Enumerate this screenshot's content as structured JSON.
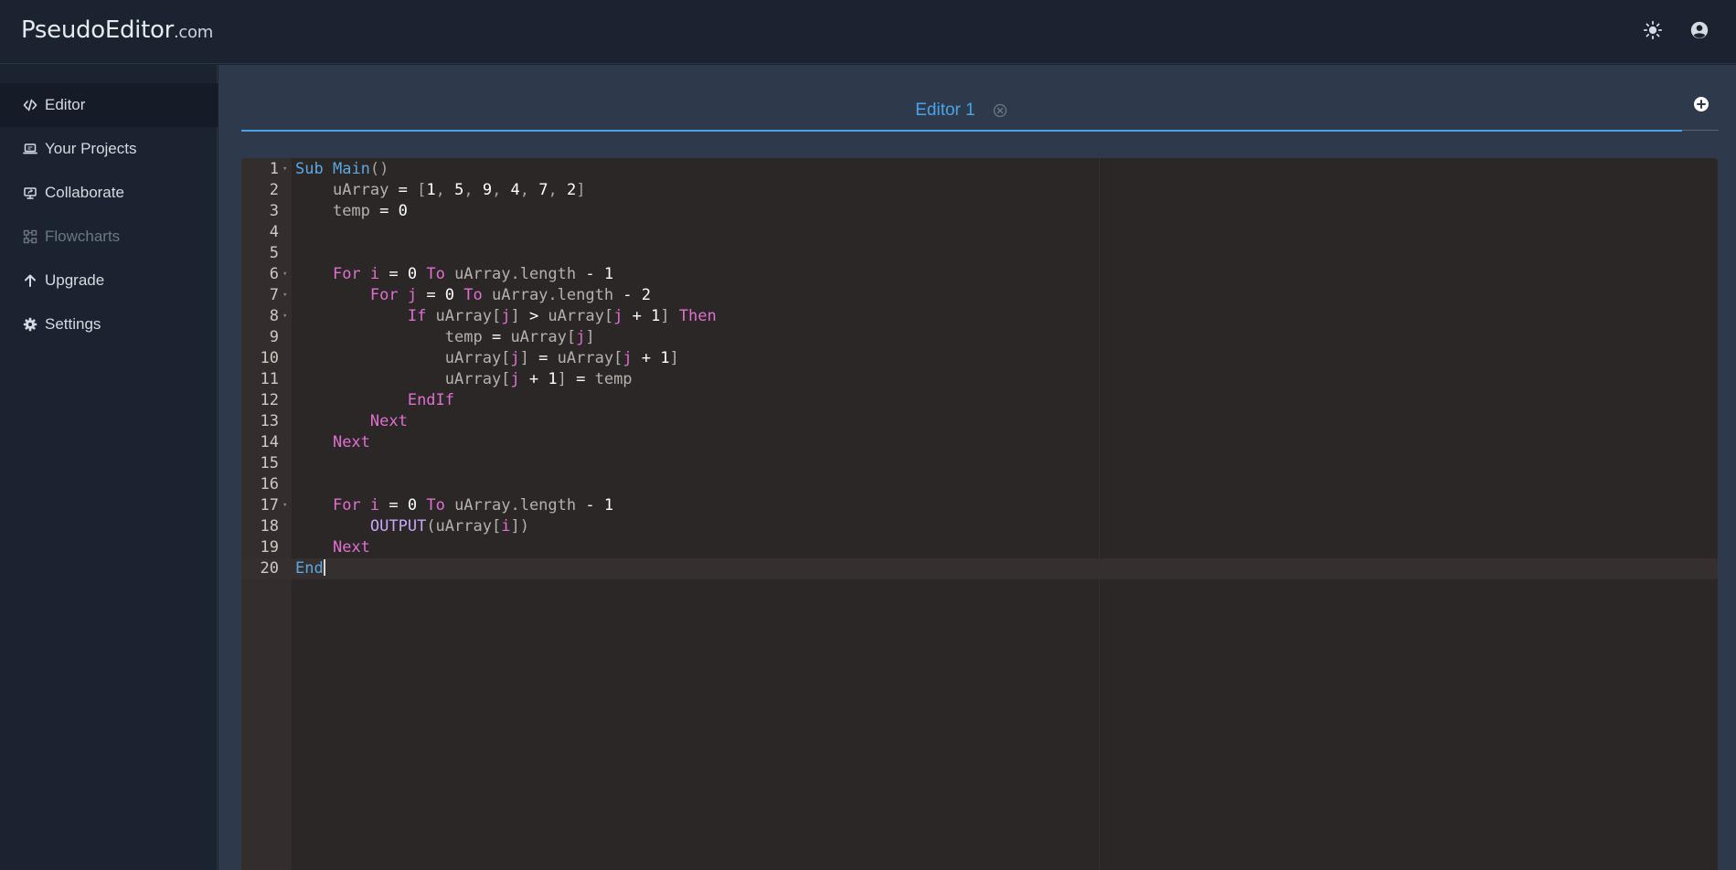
{
  "app": {
    "logo_main": "PseudoEditor",
    "logo_tld": ".com",
    "theme_icon": "sun-icon",
    "account_icon": "user-circle-icon"
  },
  "sidebar": {
    "items": [
      {
        "label": "Editor",
        "icon": "code-icon",
        "state": "active"
      },
      {
        "label": "Your Projects",
        "icon": "laptop-icon",
        "state": "normal"
      },
      {
        "label": "Collaborate",
        "icon": "share-screen-icon",
        "state": "normal"
      },
      {
        "label": "Flowcharts",
        "icon": "flowchart-icon",
        "state": "disabled"
      },
      {
        "label": "Upgrade",
        "icon": "arrow-up-icon",
        "state": "normal"
      },
      {
        "label": "Settings",
        "icon": "gear-icon",
        "state": "normal"
      }
    ]
  },
  "tabs": [
    {
      "label": "Editor 1",
      "active": true
    }
  ],
  "editor": {
    "current_line": 20,
    "lines": [
      [
        [
          "kw-blue",
          "Sub"
        ],
        [
          "",
          "' '"
        ],
        [
          "kw-blue",
          "Main"
        ],
        [
          "punc",
          "()"
        ]
      ],
      [
        [
          "",
          "    "
        ],
        [
          "var",
          "uArray"
        ],
        [
          "",
          ""
        ],
        [
          "num",
          " = "
        ],
        [
          "punc",
          "["
        ],
        [
          "num",
          "1"
        ],
        [
          "punc",
          ", "
        ],
        [
          "num",
          "5"
        ],
        [
          "punc",
          ", "
        ],
        [
          "num",
          "9"
        ],
        [
          "punc",
          ", "
        ],
        [
          "num",
          "4"
        ],
        [
          "punc",
          ", "
        ],
        [
          "num",
          "7"
        ],
        [
          "punc",
          ", "
        ],
        [
          "num",
          "2"
        ],
        [
          "punc",
          "]"
        ]
      ],
      [
        [
          "",
          "    "
        ],
        [
          "var",
          "temp"
        ],
        [
          "num",
          " = 0"
        ]
      ],
      [],
      [],
      [
        [
          "",
          "    "
        ],
        [
          "kw-pink",
          "For"
        ],
        [
          "",
          ""
        ],
        [
          "kw-pink",
          " i"
        ],
        [
          "num",
          " = 0 "
        ],
        [
          "kw-pink",
          "To"
        ],
        [
          "var",
          " uArray.length"
        ],
        [
          "num",
          " - 1"
        ]
      ],
      [
        [
          "",
          "        "
        ],
        [
          "kw-pink",
          "For"
        ],
        [
          "kw-pink",
          " j"
        ],
        [
          "num",
          " = 0 "
        ],
        [
          "kw-pink",
          "To"
        ],
        [
          "var",
          " uArray.length"
        ],
        [
          "num",
          " - 2"
        ]
      ],
      [
        [
          "",
          "            "
        ],
        [
          "kw-pink",
          "If"
        ],
        [
          "var",
          " uArray["
        ],
        [
          "kw-pink",
          "j"
        ],
        [
          "var",
          "]"
        ],
        [
          "num",
          " > "
        ],
        [
          "var",
          "uArray["
        ],
        [
          "kw-pink",
          "j"
        ],
        [
          "num",
          " + 1"
        ],
        [
          "var",
          "]"
        ],
        [
          "kw-pink",
          " Then"
        ]
      ],
      [
        [
          "",
          "                "
        ],
        [
          "var",
          "temp"
        ],
        [
          "num",
          " = "
        ],
        [
          "var",
          "uArray["
        ],
        [
          "kw-pink",
          "j"
        ],
        [
          "var",
          "]"
        ]
      ],
      [
        [
          "",
          "                "
        ],
        [
          "var",
          "uArray["
        ],
        [
          "kw-pink",
          "j"
        ],
        [
          "var",
          "]"
        ],
        [
          "num",
          " = "
        ],
        [
          "var",
          "uArray["
        ],
        [
          "kw-pink",
          "j"
        ],
        [
          "num",
          " + 1"
        ],
        [
          "var",
          "]"
        ]
      ],
      [
        [
          "",
          "                "
        ],
        [
          "var",
          "uArray["
        ],
        [
          "kw-pink",
          "j"
        ],
        [
          "num",
          " + 1"
        ],
        [
          "var",
          "]"
        ],
        [
          "num",
          " = "
        ],
        [
          "var",
          "temp"
        ]
      ],
      [
        [
          "",
          "            "
        ],
        [
          "kw-pink",
          "EndIf"
        ]
      ],
      [
        [
          "",
          "        "
        ],
        [
          "kw-pink",
          "Next"
        ]
      ],
      [
        [
          "",
          "    "
        ],
        [
          "kw-pink",
          "Next"
        ]
      ],
      [],
      [],
      [
        [
          "",
          "    "
        ],
        [
          "kw-pink",
          "For"
        ],
        [
          "kw-pink",
          " i"
        ],
        [
          "num",
          " = 0 "
        ],
        [
          "kw-pink",
          "To"
        ],
        [
          "var",
          " uArray.length"
        ],
        [
          "num",
          " - 1"
        ]
      ],
      [
        [
          "",
          "        "
        ],
        [
          "kw-purple",
          "OUTPUT"
        ],
        [
          "var",
          "(uArray["
        ],
        [
          "kw-pink",
          "i"
        ],
        [
          "var",
          "])"
        ]
      ],
      [
        [
          "",
          "    "
        ],
        [
          "kw-pink",
          "Next"
        ]
      ],
      [
        [
          "kw-blue",
          "End"
        ]
      ]
    ],
    "fold_lines": [
      1,
      6,
      7,
      8,
      17
    ]
  }
}
